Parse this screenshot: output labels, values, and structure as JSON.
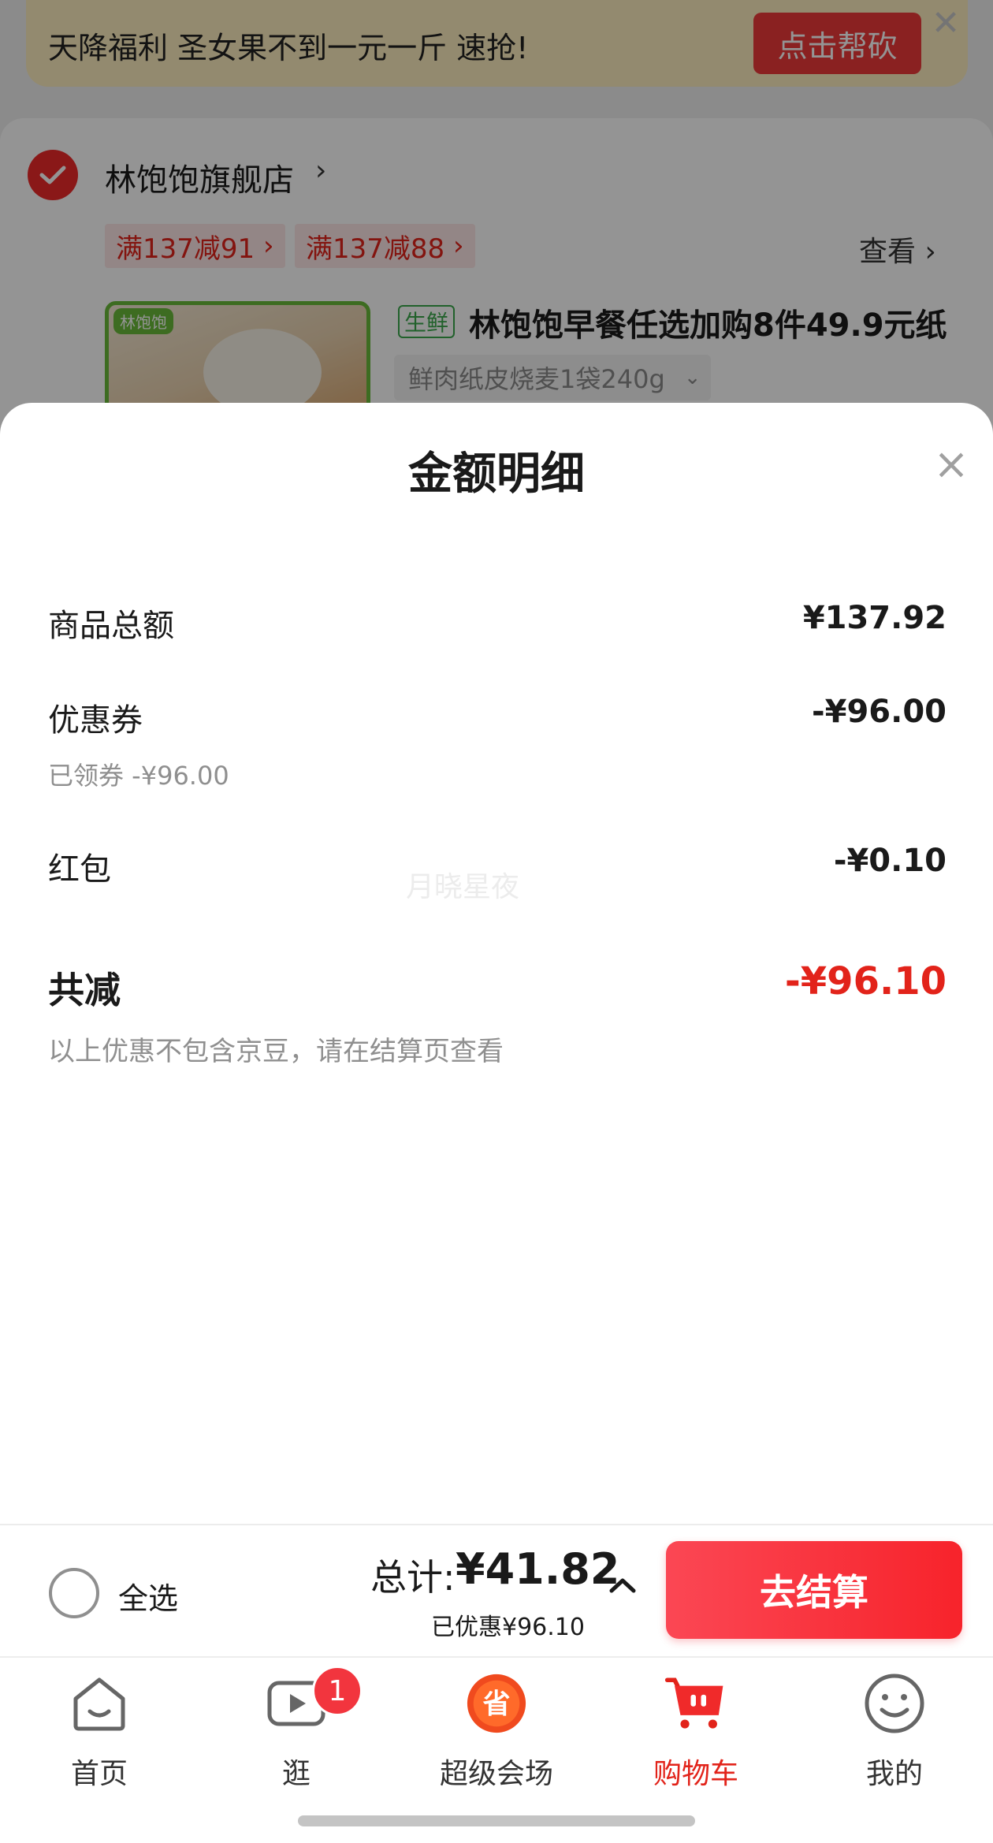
{
  "promo_banner": {
    "text": "天降福利 圣女果不到一元一斤 速抢!",
    "button": "点击帮砍",
    "close_icon": "close-icon"
  },
  "store": {
    "name": "林饱饱旗舰店",
    "tags": [
      "满137减91",
      "满137减88"
    ],
    "view_link": "查看",
    "product": {
      "image_label": "林饱饱",
      "fresh_tag": "生鲜",
      "title": "林饱饱早餐任选加购8件49.9元纸",
      "sku": "鲜肉纸皮烧麦1袋240g"
    }
  },
  "sheet": {
    "title": "金额明细",
    "rows": [
      {
        "label": "商品总额",
        "value": "¥137.92"
      },
      {
        "label": "优惠券",
        "value": "-¥96.00",
        "sub": "已领券 -¥96.00"
      },
      {
        "label": "红包",
        "value": "-¥0.10"
      }
    ],
    "total": {
      "label": "共减",
      "value": "-¥96.10",
      "note": "以上优惠不包含京豆，请在结算页查看"
    },
    "watermark": "月晓星夜"
  },
  "checkout": {
    "select_all": "全选",
    "total_prefix": "总计:",
    "total_amount": "¥41.82",
    "saved": "已优惠¥96.10",
    "button": "去结算"
  },
  "tabs": [
    {
      "label": "首页",
      "icon": "home-icon"
    },
    {
      "label": "逛",
      "icon": "video-icon",
      "badge": "1"
    },
    {
      "label": "超级会场",
      "icon": "super-venue-icon"
    },
    {
      "label": "购物车",
      "icon": "cart-icon",
      "active": true
    },
    {
      "label": "我的",
      "icon": "profile-icon"
    }
  ],
  "colors": {
    "accent": "#e2231a",
    "checkout_button": "#f7232b",
    "fresh_green": "#3aa84a"
  }
}
